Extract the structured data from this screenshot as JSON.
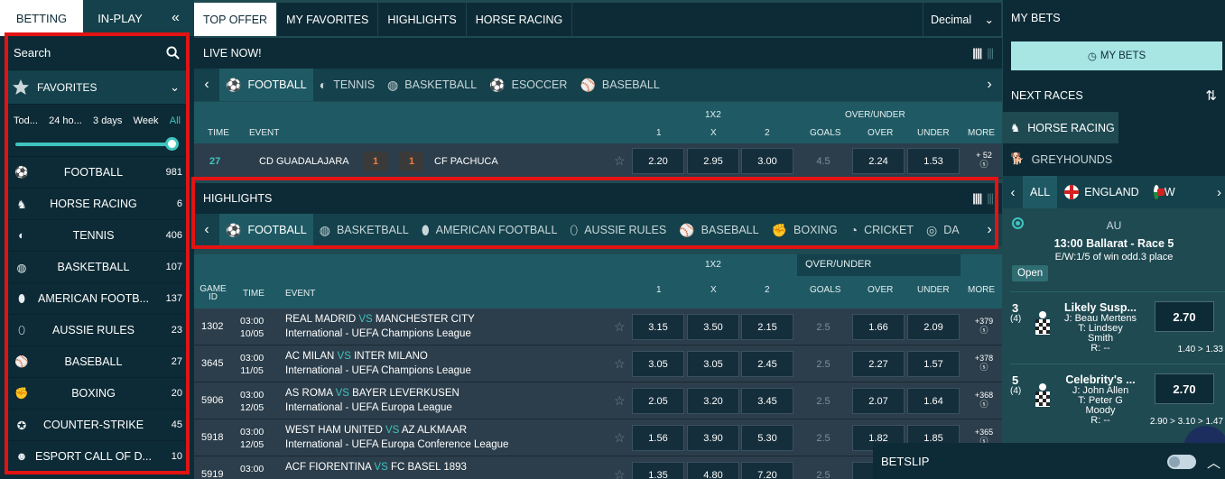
{
  "left": {
    "tabs": [
      "BETTING",
      "IN-PLAY"
    ],
    "collapse_icon": "double-chevron-left-icon",
    "search_label": "Search",
    "favorites_label": "FAVORITES",
    "time_options": [
      "Tod...",
      "24 ho...",
      "3 days",
      "Week",
      "All"
    ],
    "time_selected": "All",
    "sports": [
      {
        "name": "FOOTBALL",
        "count": "981",
        "icon": "soccer-ball-icon"
      },
      {
        "name": "HORSE RACING",
        "count": "6",
        "icon": "horse-icon"
      },
      {
        "name": "TENNIS",
        "count": "406",
        "icon": "tennis-ball-icon"
      },
      {
        "name": "BASKETBALL",
        "count": "107",
        "icon": "basketball-icon"
      },
      {
        "name": "AMERICAN FOOTB...",
        "count": "137",
        "icon": "american-football-icon"
      },
      {
        "name": "AUSSIE RULES",
        "count": "23",
        "icon": "aussie-rules-ball-icon"
      },
      {
        "name": "BASEBALL",
        "count": "27",
        "icon": "baseball-icon"
      },
      {
        "name": "BOXING",
        "count": "20",
        "icon": "boxing-icon"
      },
      {
        "name": "COUNTER-STRIKE",
        "count": "45",
        "icon": "counter-strike-icon"
      },
      {
        "name": "ESPORT CALL OF D...",
        "count": "10",
        "icon": "esport-icon"
      }
    ]
  },
  "nav": {
    "items": [
      "TOP OFFER",
      "MY FAVORITES",
      "HIGHLIGHTS",
      "HORSE RACING"
    ],
    "odds_format": "Decimal"
  },
  "live": {
    "title": "LIVE NOW!",
    "sports": [
      "FOOTBALL",
      "TENNIS",
      "BASKETBALL",
      "ESOCCER",
      "BASEBALL"
    ],
    "header": {
      "group1": "1X2",
      "group2": "OVER/UNDER",
      "time": "TIME",
      "event": "EVENT",
      "c1": "1",
      "cx": "X",
      "c2": "2",
      "goals": "GOALS",
      "over": "OVER",
      "under": "UNDER",
      "more": "MORE"
    },
    "row": {
      "time": "27",
      "home": "CD GUADALAJARA",
      "home_score": "1",
      "away_score": "1",
      "away": "CF PACHUCA",
      "o1": "2.20",
      "ox": "2.95",
      "o2": "3.00",
      "goals": "4.5",
      "over": "2.24",
      "under": "1.53",
      "more": "+ 52"
    }
  },
  "highlights": {
    "title": "HIGHLIGHTS",
    "sports": [
      "FOOTBALL",
      "BASKETBALL",
      "AMERICAN FOOTBALL",
      "AUSSIE RULES",
      "BASEBALL",
      "BOXING",
      "CRICKET",
      "DA"
    ],
    "header": {
      "group1": "1X2",
      "market": "OVER/UNDER",
      "gameid": "GAME ID",
      "time": "TIME",
      "event": "EVENT",
      "c1": "1",
      "cx": "X",
      "c2": "2",
      "goals": "GOALS",
      "over": "OVER",
      "under": "UNDER",
      "more": "MORE"
    },
    "matches": [
      {
        "id": "1302",
        "time": "03:00",
        "date": "10/05",
        "home": "REAL MADRID",
        "vs": "VS",
        "away": "MANCHESTER CITY",
        "league": "International - UEFA Champions League",
        "o1": "3.15",
        "ox": "3.50",
        "o2": "2.15",
        "goals": "2.5",
        "over": "1.66",
        "under": "2.09",
        "more": "+379"
      },
      {
        "id": "3645",
        "time": "03:00",
        "date": "11/05",
        "home": "AC MILAN",
        "vs": "VS",
        "away": "INTER MILANO",
        "league": "International - UEFA Champions League",
        "o1": "3.05",
        "ox": "3.05",
        "o2": "2.45",
        "goals": "2.5",
        "over": "2.27",
        "under": "1.57",
        "more": "+378"
      },
      {
        "id": "5906",
        "time": "03:00",
        "date": "12/05",
        "home": "AS ROMA",
        "vs": "VS",
        "away": "BAYER LEVERKUSEN",
        "league": "International - UEFA Europa League",
        "o1": "2.05",
        "ox": "3.20",
        "o2": "3.45",
        "goals": "2.5",
        "over": "2.07",
        "under": "1.64",
        "more": "+368"
      },
      {
        "id": "5918",
        "time": "03:00",
        "date": "12/05",
        "home": "WEST HAM UNITED",
        "vs": "VS",
        "away": "AZ ALKMAAR",
        "league": "International - UEFA Europa Conference League",
        "o1": "1.56",
        "ox": "3.90",
        "o2": "5.30",
        "goals": "2.5",
        "over": "1.82",
        "under": "1.85",
        "more": "+365"
      },
      {
        "id": "5919",
        "time": "03:00",
        "date": "",
        "home": "ACF FIORENTINA",
        "vs": "VS",
        "away": "FC BASEL 1893",
        "league": "",
        "o1": "1.35",
        "ox": "4.80",
        "o2": "7.20",
        "goals": "2.5",
        "over": "",
        "under": "",
        "more": ""
      }
    ]
  },
  "right": {
    "my_bets_title": "MY BETS",
    "my_bets_button": "MY BETS",
    "next_races": "NEXT RACES",
    "race_types": [
      "HORSE RACING",
      "GREYHOUNDS"
    ],
    "countries": [
      "ALL",
      "ENGLAND",
      "W"
    ],
    "race": {
      "region": "AU",
      "time": "13:00",
      "name": "Ballarat - Race 5",
      "terms": "E/W:1/5 of win odd.3 place",
      "status": "Open"
    },
    "runners": [
      {
        "no": "3",
        "draw": "(4)",
        "name": "Likely Susp...",
        "jockey": "J: Beau Mertens",
        "trainer1": "T: Lindsey",
        "trainer2": "Smith",
        "rating": "R: --",
        "price": "2.70",
        "history": "1.40 > 1.33"
      },
      {
        "no": "5",
        "draw": "(4)",
        "name": "Celebrity's ...",
        "jockey": "J: John Allen",
        "trainer1": "T: Peter G",
        "trainer2": "Moody",
        "rating": "R: --",
        "price": "2.70",
        "history": "2.90 > 3.10 > 1.47"
      }
    ],
    "betslip": "BETSLIP"
  },
  "colors": {
    "accent": "#3fc4c0",
    "highlight": "#e31313",
    "dark": "#0d2b36"
  }
}
